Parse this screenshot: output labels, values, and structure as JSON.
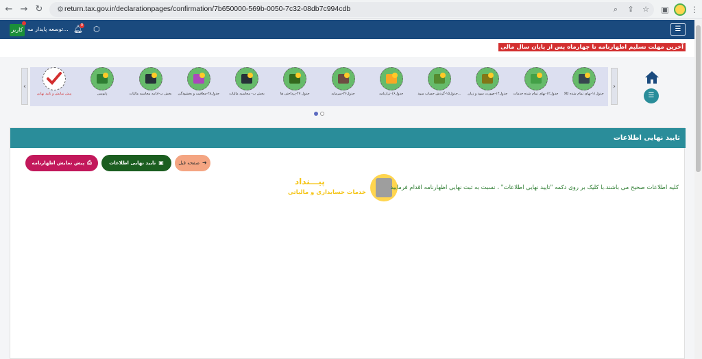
{
  "browser": {
    "url": "return.tax.gov.ir/declarationpages/confirmation/7b650000-569b-0050-7c32-08db7c994cdb"
  },
  "header": {
    "user_role": "کاربر",
    "user_name": "توسعه پایدار مه...",
    "notification_count": "0",
    "menu_icon": "menu-icon"
  },
  "alert": {
    "text": "آخرین مهلت تسلیم اظهارنامه تا چهارماه پس از پایان سال مالی"
  },
  "steps": [
    {
      "label": "جدول۱۱-بهای تمام شده کالا",
      "icon": "product-cost-icon",
      "color": "#37474f"
    },
    {
      "label": "جدول۱۲-بهای تمام شده خدمات",
      "icon": "service-cost-icon",
      "color": "#43a047"
    },
    {
      "label": "جدول۱۴-صورت سود و زیان",
      "icon": "scale-icon",
      "color": "#827717"
    },
    {
      "label": "جدول۱۵-گردش حساب سود...",
      "icon": "flow-icon",
      "color": "#558b2f"
    },
    {
      "label": "جدول۱۶-ترازنامه",
      "icon": "balance-sheet-icon",
      "color": "#f9a825"
    },
    {
      "label": "جدول۲۶-سرمایه",
      "icon": "capital-icon",
      "color": "#6d4c41"
    },
    {
      "label": "جدول ۲۷-پرداختی ها",
      "icon": "payments-icon",
      "color": "#33691e"
    },
    {
      "label": "بخش ب- محاسبه مالیات",
      "icon": "tax-calc-icon",
      "color": "#263238"
    },
    {
      "label": "جدول۲۸-معافیت و بخشودگی",
      "icon": "exemption-icon",
      "color": "#ab47bc"
    },
    {
      "label": "بخش ب-ادامه محاسبه مالیات",
      "icon": "tax-calc-continue-icon",
      "color": "#263238"
    },
    {
      "label": "پانویس",
      "icon": "footnote-icon",
      "color": "#2e7d32"
    },
    {
      "label": "پیش نمایش و تایید نهایی",
      "icon": "check-icon",
      "color": "#d32f2f"
    }
  ],
  "card": {
    "title": "تایید نهایی اطلاعات",
    "btn_preview": "پیش نمایش اظهارنامه",
    "btn_confirm": "تایید نهایی اطلاعات",
    "btn_prev": "صفحه قبل",
    "info": "کلیه اطلاعات صحیح می باشند.با کلیک بر روی دکمه \"تایید نهایی اطلاعات\" ، نسبت به ثبت نهایی اظهارنامه اقدام فرمایید"
  },
  "watermark": {
    "title": "پیـــنداد",
    "subtitle": "خدمات حسابداری و مالیاتی"
  },
  "colors": {
    "header": "#1a4a7e",
    "teal": "#2a8d9a",
    "alert": "#d32f2f"
  }
}
